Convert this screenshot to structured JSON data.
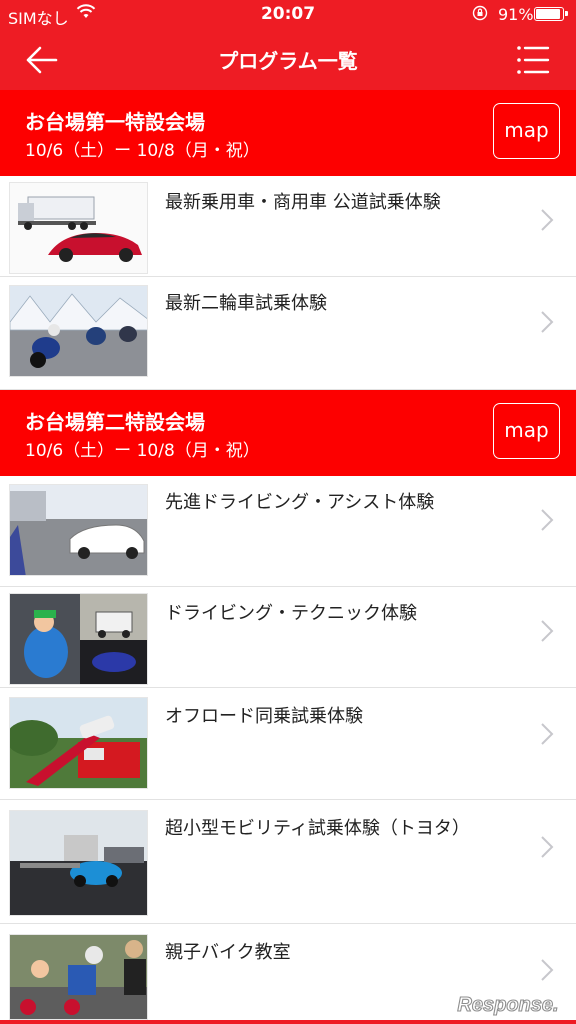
{
  "status": {
    "carrier": "SIMなし",
    "time": "20:07",
    "battery": "91%"
  },
  "nav": {
    "title": "プログラム一覧",
    "back_icon": "arrow-left-icon",
    "menu_icon": "hamburger-menu-icon"
  },
  "sections": [
    {
      "venue": "お台場第一特設会場",
      "dates": "10/6（土）ー 10/8（月・祝）",
      "map_label": "map",
      "programs": [
        {
          "title": "最新乗用車・商用車 公道試乗体験"
        },
        {
          "title": "最新二輪車試乗体験"
        }
      ]
    },
    {
      "venue": "お台場第二特設会場",
      "dates": "10/6（土）ー 10/8（月・祝）",
      "map_label": "map",
      "programs": [
        {
          "title": "先進ドライビング・アシスト体験"
        },
        {
          "title": "ドライビング・テクニック体験"
        },
        {
          "title": "オフロード同乗試乗体験"
        },
        {
          "title": "超小型モビリティ試乗体験（トヨタ）"
        },
        {
          "title": "親子バイク教室"
        }
      ]
    }
  ],
  "watermark": "Response.",
  "colors": {
    "accent": "#ee1c24",
    "section": "#fd0000"
  }
}
